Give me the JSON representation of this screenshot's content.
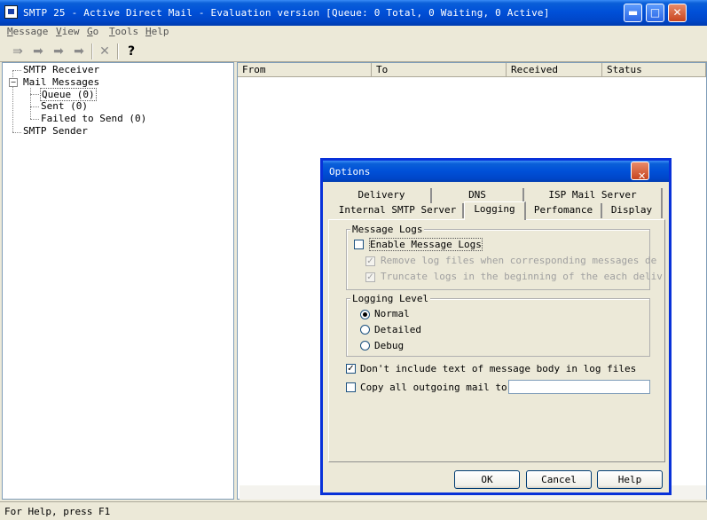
{
  "window": {
    "title": "SMTP 25 - Active Direct Mail - Evaluation version [Queue:    0 Total, 0 Waiting, 0 Active]",
    "minimize": "▬",
    "maximize": "□",
    "close": "✕"
  },
  "menu": [
    "Message",
    "View",
    "Go",
    "Tools",
    "Help"
  ],
  "toolbar": {
    "icons": [
      "send-receive-icon",
      "forward-icon",
      "forward-all-icon",
      "forward-next-icon",
      "delete-icon",
      "help-icon"
    ]
  },
  "tree": {
    "smtp_receiver": "SMTP Receiver",
    "mail_messages": "Mail Messages",
    "queue": "Queue (0)",
    "sent": "Sent (0)",
    "failed": "Failed to Send (0)",
    "smtp_sender": "SMTP Sender",
    "expander": "−"
  },
  "list": {
    "columns": [
      "From",
      "To",
      "Received",
      "Status"
    ]
  },
  "status": "For Help, press F1",
  "dialog": {
    "title": "Options",
    "close": "✕",
    "tabs_row1": [
      "Delivery",
      "DNS",
      "ISP Mail Server"
    ],
    "tabs_row2": [
      "Internal SMTP Server",
      "Logging",
      "Perfomance",
      "Display"
    ],
    "message_logs": {
      "label": "Message Logs",
      "enable": "Enable Message Logs",
      "remove": "Remove log files when corresponding messages de",
      "truncate": "Truncate logs in the beginning of the each deliv",
      "check": "✓"
    },
    "logging_level": {
      "label": "Logging Level",
      "options": [
        "Normal",
        "Detailed",
        "Debug"
      ],
      "selected": "Normal"
    },
    "dont_include": "Don't include text of message body in log files",
    "copy_all": "Copy all outgoing mail to:",
    "copy_value": "",
    "buttons": {
      "ok": "OK",
      "cancel": "Cancel",
      "help": "Help"
    }
  }
}
